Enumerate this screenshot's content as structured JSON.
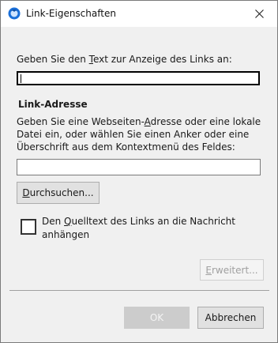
{
  "window": {
    "title": "Link-Eigenschaften",
    "icon": "thunderbird-app-icon",
    "close_icon": "close-icon"
  },
  "link_text": {
    "label_pre": "Geben Sie den ",
    "label_key": "T",
    "label_post": "ext zur Anzeige des Links an:",
    "value": ""
  },
  "link_address": {
    "section_title": "Link-Adresse",
    "desc_line1_pre": "Geben Sie eine Webseiten-",
    "desc_line1_key": "A",
    "desc_line1_post": "dresse oder eine lokale",
    "desc_line2": "Datei ein, oder wählen Sie einen Anker oder eine",
    "desc_line3": "Überschrift aus dem Kontextmenü des Feldes:",
    "value": ""
  },
  "buttons": {
    "browse_key": "D",
    "browse_rest": "urchsuchen...",
    "advanced_key": "E",
    "advanced_rest": "rweitert...",
    "ok": "OK",
    "cancel": "Abbrechen"
  },
  "checkbox": {
    "line1_pre": "Den ",
    "line1_key": "Q",
    "line1_post": "uelltext des Links an die Nachricht",
    "line2": "anhängen",
    "checked": false
  }
}
